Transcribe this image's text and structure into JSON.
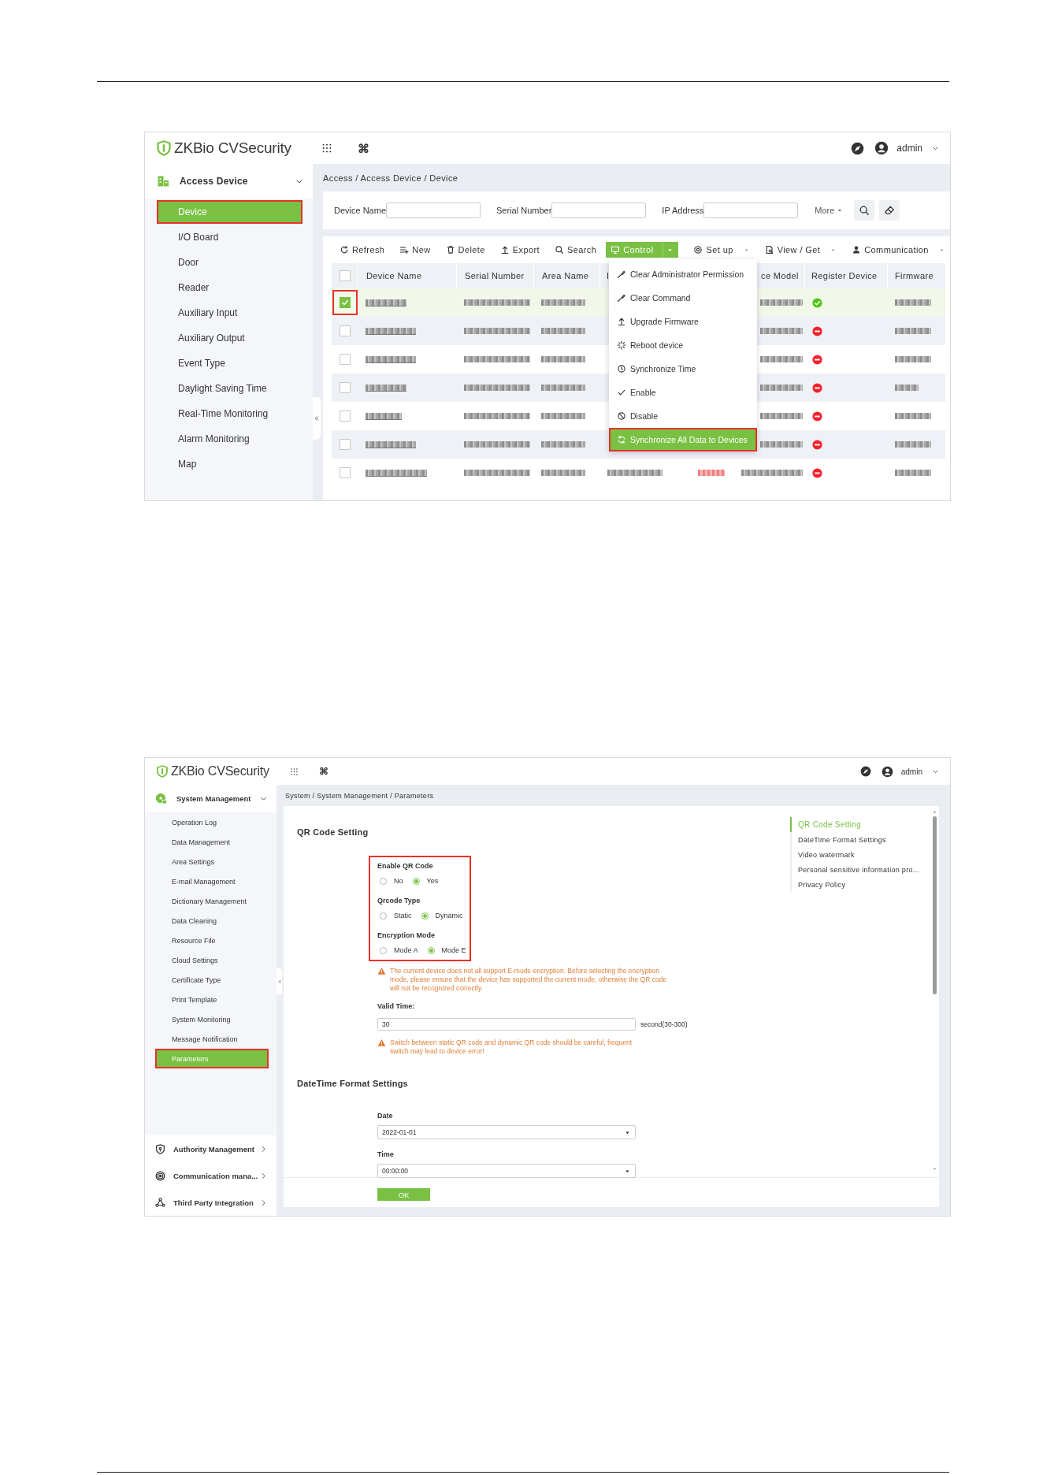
{
  "device_screen": {
    "header": {
      "logo": "ZKBio CVSecurity",
      "command_glyph": "⌘",
      "user": "admin"
    },
    "sidebar": {
      "group": {
        "label": "Access Device",
        "expanded": true
      },
      "items": [
        {
          "label": "Device",
          "selected": true,
          "callout": true
        },
        {
          "label": "I/O Board",
          "selected": false,
          "callout": false
        },
        {
          "label": "Door",
          "selected": false,
          "callout": false
        },
        {
          "label": "Reader",
          "selected": false,
          "callout": false
        },
        {
          "label": "Auxiliary Input",
          "selected": false,
          "callout": false
        },
        {
          "label": "Auxiliary Output",
          "selected": false,
          "callout": false
        },
        {
          "label": "Event Type",
          "selected": false,
          "callout": false
        },
        {
          "label": "Daylight Saving Time",
          "selected": false,
          "callout": false
        },
        {
          "label": "Real-Time Monitoring",
          "selected": false,
          "callout": false
        },
        {
          "label": "Alarm Monitoring",
          "selected": false,
          "callout": false
        },
        {
          "label": "Map",
          "selected": false,
          "callout": false
        }
      ]
    },
    "breadcrumb": "Access / Access Device / Device",
    "filters": [
      {
        "label": "Device Name"
      },
      {
        "label": "Serial Number"
      },
      {
        "label": "IP Address"
      }
    ],
    "more": "More",
    "toolbar": [
      {
        "label": "Refresh",
        "kind": "plain"
      },
      {
        "label": "New",
        "kind": "plain"
      },
      {
        "label": "Delete",
        "kind": "plain"
      },
      {
        "label": "Export",
        "kind": "plain"
      },
      {
        "label": "Search",
        "kind": "plain"
      },
      {
        "label": "Control",
        "kind": "primary",
        "expanded": true
      },
      {
        "label": "Set up",
        "kind": "dropdown"
      },
      {
        "label": "View / Get",
        "kind": "dropdown"
      },
      {
        "label": "Communication",
        "kind": "dropdown"
      }
    ],
    "table": {
      "header_checked": false,
      "columns": [
        "Device Name",
        "Serial Number",
        "Area Name",
        "I",
        "ce Model",
        "Register Device",
        "Firmware"
      ],
      "rows": [
        {
          "selected": true,
          "callout": true,
          "registered": true
        },
        {
          "selected": false,
          "callout": false,
          "registered": false
        },
        {
          "selected": false,
          "callout": false,
          "registered": false
        },
        {
          "selected": false,
          "callout": false,
          "registered": false
        },
        {
          "selected": false,
          "callout": false,
          "registered": false
        },
        {
          "selected": false,
          "callout": false,
          "registered": false
        },
        {
          "selected": false,
          "callout": false,
          "registered": false,
          "online": false
        }
      ]
    },
    "control_menu": {
      "items": [
        {
          "label": "Clear Administrator Permission",
          "selected": false,
          "callout": false
        },
        {
          "label": "Clear Command",
          "selected": false,
          "callout": false
        },
        {
          "label": "Upgrade Firmware",
          "selected": false,
          "callout": false
        },
        {
          "label": "Reboot device",
          "selected": false,
          "callout": false
        },
        {
          "label": "Synchronize Time",
          "selected": false,
          "callout": false
        },
        {
          "label": "Enable",
          "selected": false,
          "callout": false
        },
        {
          "label": "Disable",
          "selected": false,
          "callout": false
        },
        {
          "label": "Synchronize All Data to Devices",
          "selected": true,
          "callout": true
        }
      ]
    }
  },
  "parameters_screen": {
    "header": {
      "logo": "ZKBio CVSecurity",
      "command_glyph": "⌘",
      "user": "admin"
    },
    "sidebar": {
      "group": {
        "label": "System Management",
        "expanded": true
      },
      "items": [
        {
          "label": "Operation Log",
          "selected": false,
          "callout": false
        },
        {
          "label": "Data Management",
          "selected": false,
          "callout": false
        },
        {
          "label": "Area Settings",
          "selected": false,
          "callout": false
        },
        {
          "label": "E-mail Management",
          "selected": false,
          "callout": false
        },
        {
          "label": "Dictionary Management",
          "selected": false,
          "callout": false
        },
        {
          "label": "Data Cleaning",
          "selected": false,
          "callout": false
        },
        {
          "label": "Resource File",
          "selected": false,
          "callout": false
        },
        {
          "label": "Cloud Settings",
          "selected": false,
          "callout": false
        },
        {
          "label": "Certificate Type",
          "selected": false,
          "callout": false
        },
        {
          "label": "Print Template",
          "selected": false,
          "callout": false
        },
        {
          "label": "System Monitoring",
          "selected": false,
          "callout": false
        },
        {
          "label": "Message Notification",
          "selected": false,
          "callout": false
        },
        {
          "label": "Parameters",
          "selected": true,
          "callout": true
        }
      ],
      "other_groups": [
        {
          "label": "Authority Management",
          "expanded": false
        },
        {
          "label": "Communication mana...",
          "expanded": false
        },
        {
          "label": "Third Party Integration",
          "expanded": false
        }
      ]
    },
    "breadcrumb": "System / System Management / Parameters",
    "qr_code": {
      "title": "QR Code Setting",
      "callout": true,
      "radio_groups": [
        {
          "label": "Enable QR Code",
          "options": [
            {
              "label": "No",
              "selected": false
            },
            {
              "label": "Yes",
              "selected": true
            }
          ]
        },
        {
          "label": "Qrcode Type",
          "options": [
            {
              "label": "Static",
              "selected": false
            },
            {
              "label": "Dynamic",
              "selected": true
            }
          ]
        },
        {
          "label": "Encryption Mode",
          "options": [
            {
              "label": "Mode A",
              "selected": false
            },
            {
              "label": "Mode E",
              "selected": true
            }
          ]
        }
      ],
      "warning_1": "The current device does not all support E-mode encryption. Before selecting the encryption mode, please ensure that the device has supported the current mode, otherwise the QR code will not be recognized correctly.",
      "valid_time": {
        "label": "Valid Time:",
        "value": "30",
        "unit": "second(30-300)"
      },
      "warning_2": "Switch between static QR code and dynamic QR code should be careful, frequent switch may lead to device error!"
    },
    "datetime": {
      "title": "DateTime Format Settings",
      "date": {
        "label": "Date",
        "value": "2022-01-01"
      },
      "time": {
        "label": "Time",
        "value": "00:00:00"
      }
    },
    "ok_button": "OK",
    "anchors": [
      {
        "label": "QR Code Setting",
        "selected": true
      },
      {
        "label": "DateTime Format Settings",
        "selected": false
      },
      {
        "label": "Video watermark",
        "selected": false
      },
      {
        "label": "Personal sensitive information pro...",
        "selected": false
      },
      {
        "label": "Privacy Policy",
        "selected": false
      }
    ]
  }
}
